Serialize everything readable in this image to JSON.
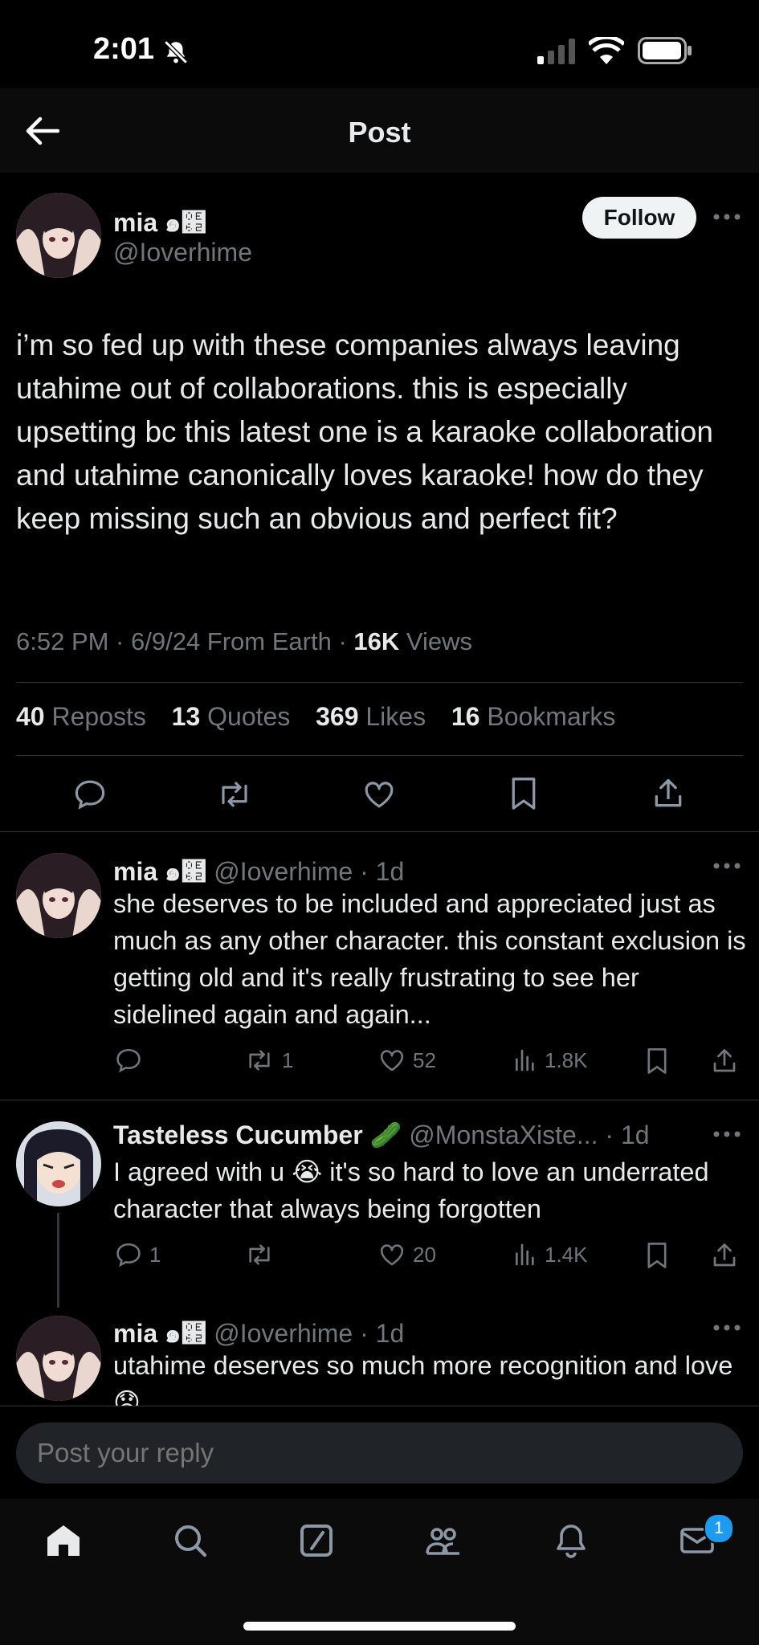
{
  "status_bar": {
    "time": "2:01"
  },
  "header": {
    "title": "Post"
  },
  "post": {
    "author_name": "mia ๑๢",
    "author_handle": "@Ioverhime",
    "follow_label": "Follow",
    "text": "i’m so fed up with these companies always leaving utahime out of collaborations. this is especially upsetting bc this latest one is a karaoke collaboration and utahime canonically loves karaoke! how do they keep missing such an obvious and perfect fit?",
    "meta_time": "6:52 PM · 6/9/24 From Earth · ",
    "meta_views_count": "16K",
    "meta_views_label": " Views",
    "stats": [
      {
        "count": "40",
        "label": "Reposts"
      },
      {
        "count": "13",
        "label": "Quotes"
      },
      {
        "count": "369",
        "label": "Likes"
      },
      {
        "count": "16",
        "label": "Bookmarks"
      }
    ]
  },
  "replies": [
    {
      "name": "mia ๑๢",
      "handle": "@Ioverhime",
      "time": "· 1d",
      "text": "she deserves to be included and appreciated just as much as any other character. this constant exclusion is getting old and it's really frustrating to see her sidelined again and again...",
      "replies_count": "",
      "reposts": "1",
      "likes": "52",
      "views": "1.8K"
    },
    {
      "name": "Tasteless Cucumber",
      "name_emoji": "🥒",
      "handle": "@MonstaXiste...",
      "time": "· 1d",
      "text_before_emoji": "I agreed with u ",
      "emoji": "😭",
      "text_after_emoji": " it's so hard to love an underrated character that always being forgotten",
      "replies_count": "1",
      "reposts": "",
      "likes": "20",
      "views": "1.4K"
    },
    {
      "name": "mia ๑๢",
      "handle": "@Ioverhime",
      "time": "· 1d",
      "text": "utahime deserves so much more recognition and love",
      "emoji": "😞"
    }
  ],
  "reply_input": {
    "placeholder": "Post your reply"
  },
  "tab_bar": {
    "messages_badge": "1"
  },
  "colors": {
    "background": "#000000",
    "text": "#e7e9ea",
    "secondary": "#71767b",
    "divider": "#2f3336",
    "badge": "#1d9bf0"
  }
}
